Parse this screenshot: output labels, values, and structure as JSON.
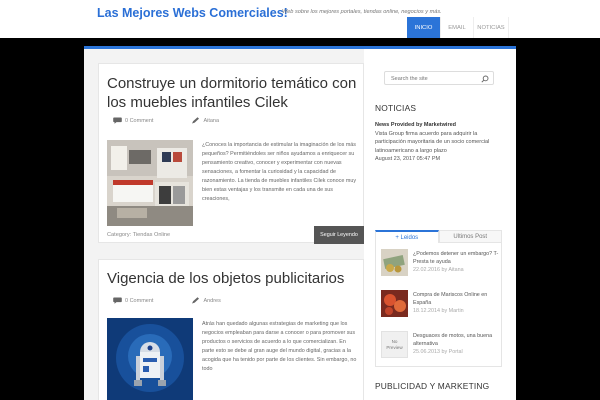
{
  "header": {
    "site_title": "Las Mejores Webs Comerciales!",
    "tagline": "Web sobre los mejores portales, tiendas online, negocios y más."
  },
  "nav": [
    {
      "label": "INICIO",
      "active": true
    },
    {
      "label": "EMAIL",
      "active": false
    },
    {
      "label": "NOTICIAS",
      "active": false
    }
  ],
  "posts": [
    {
      "title": "Construye un dormitorio temático con los muebles infantiles Cilek",
      "comments": "0 Comment",
      "author": "Aitana",
      "excerpt": "¿Conoces la importancia de estimular la imaginación de los más pequeños? Permitiéndoles ser niños ayudamos a enriquecer su pensamiento creativo, conocer y experimentar con nuevas sensaciones, a fomentar la curiosidad y la capacidad de razonamiento. La tienda de muebles infantiles Cilek conoce muy bien estas ventajas y los transmite en cada una de sus creaciones,",
      "category_label": "Category:",
      "category": "Tiendas Online",
      "read_more": "Seguir Leyendo"
    },
    {
      "title": "Vigencia de los objetos publicitarios",
      "comments": "0 Comment",
      "author": "Andres",
      "excerpt": "Atrás han quedado algunas estrategias de marketing que los negocios empleaban para darse a conocer o para promover sus productos o servicios de acuerdo a lo que comercializan. En parte esto se debe al gran auge del mundo digital, gracias a la acogida que ha tenido por parte de los clientes. Sin embargo, no todo"
    }
  ],
  "sidebar": {
    "search_placeholder": "Search the site",
    "news_title": "NOTICIAS",
    "news_provider": "News Provided by Marketwired",
    "news_text": "Vista Group firma acuerdo para adquirir la participación mayoritaria de un socio comercial latinoamericano a largo plazo",
    "news_date": "August 23, 2017 05:47 PM",
    "tabs": [
      {
        "label": "+ Leidos",
        "active": true
      },
      {
        "label": "Ultimos Post",
        "active": false
      }
    ],
    "tab_items": [
      {
        "title": "¿Podemos detener un embargo? T-Presta te ayuda",
        "date": "22.02.2016 by Aitana"
      },
      {
        "title": "Compra de Mariscos Online en España",
        "date": "18.12.2014 by Martin"
      },
      {
        "title": "Desguaces de motos, una buena alternativa",
        "date": "25.06.2013 by Portal"
      }
    ],
    "no_preview": "No Preview",
    "ads_title": "PUBLICIDAD Y MARKETING"
  },
  "colors": {
    "accent": "#2b74d8",
    "title_blue": "#2a6fd6",
    "background": "#000000"
  }
}
